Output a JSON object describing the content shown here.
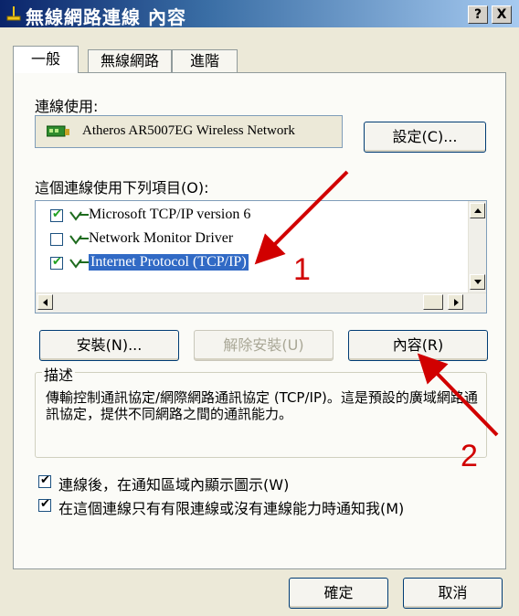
{
  "window": {
    "title": "無線網路連線 內容"
  },
  "titlebar_buttons": {
    "help": "?",
    "close": "X"
  },
  "tabs": [
    {
      "label": "一般"
    },
    {
      "label": "無線網路"
    },
    {
      "label": "進階"
    }
  ],
  "connect_using": {
    "label": "連線使用:",
    "adapter": "Atheros AR5007EG Wireless Network",
    "configure_button": "設定(C)..."
  },
  "items_section": {
    "label": "這個連線使用下列項目(O):",
    "items": [
      {
        "label": "Microsoft TCP/IP version 6",
        "checked": true
      },
      {
        "label": "Network Monitor Driver",
        "checked": false
      },
      {
        "label": "Internet Protocol (TCP/IP)",
        "checked": true,
        "selected": true
      }
    ]
  },
  "buttons": {
    "install": "安裝(N)...",
    "uninstall": "解除安裝(U)",
    "properties": "內容(R)"
  },
  "description": {
    "title": "描述",
    "text": "傳輸控制通訊協定/網際網路通訊協定 (TCP/IP)。這是預設的廣域網路通訊協定，提供不同網路之間的通訊能力。"
  },
  "options": [
    {
      "label": "連線後，在通知區域內顯示圖示(W)",
      "checked": true
    },
    {
      "label": "在這個連線只有有限連線或沒有連線能力時通知我(M)",
      "checked": true
    }
  ],
  "footer": {
    "ok": "確定",
    "cancel": "取消"
  },
  "annotations": {
    "step1": "1",
    "step2": "2",
    "color": "#d10000"
  }
}
